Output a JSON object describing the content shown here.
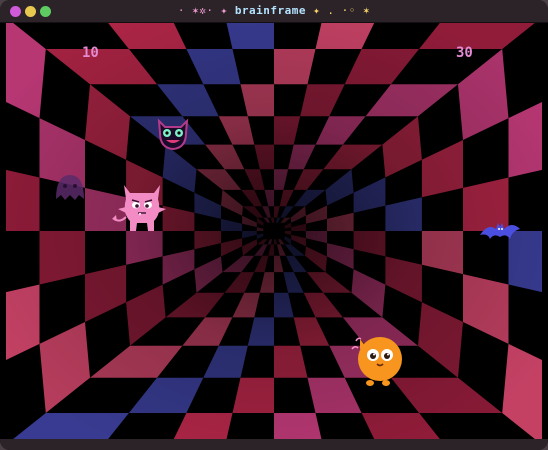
{
  "window": {
    "title": "brainframe",
    "title_decor_left": "· ✶✲· ✦",
    "title_decor_right": "✦ . ·◦ ✶"
  },
  "scores": {
    "left": "10",
    "right": "30"
  },
  "colors": {
    "tile_red": "#b8274a",
    "tile_pink": "#c23a7a",
    "tile_blue": "#3b3f9a",
    "pink_monster": "#f38bc4",
    "orange_player": "#f7951f",
    "devil_face": "#b23a8a",
    "purple_ghost": "#5a2a6a",
    "bat": "#4b4fe0"
  },
  "sprites": {
    "devil": "devil-face-sprite",
    "pink_monster": "pink-devil-monster-sprite",
    "purple_ghost": "purple-ghost-sprite",
    "bat": "blue-bat-sprite",
    "player": "orange-blob-player-sprite"
  }
}
